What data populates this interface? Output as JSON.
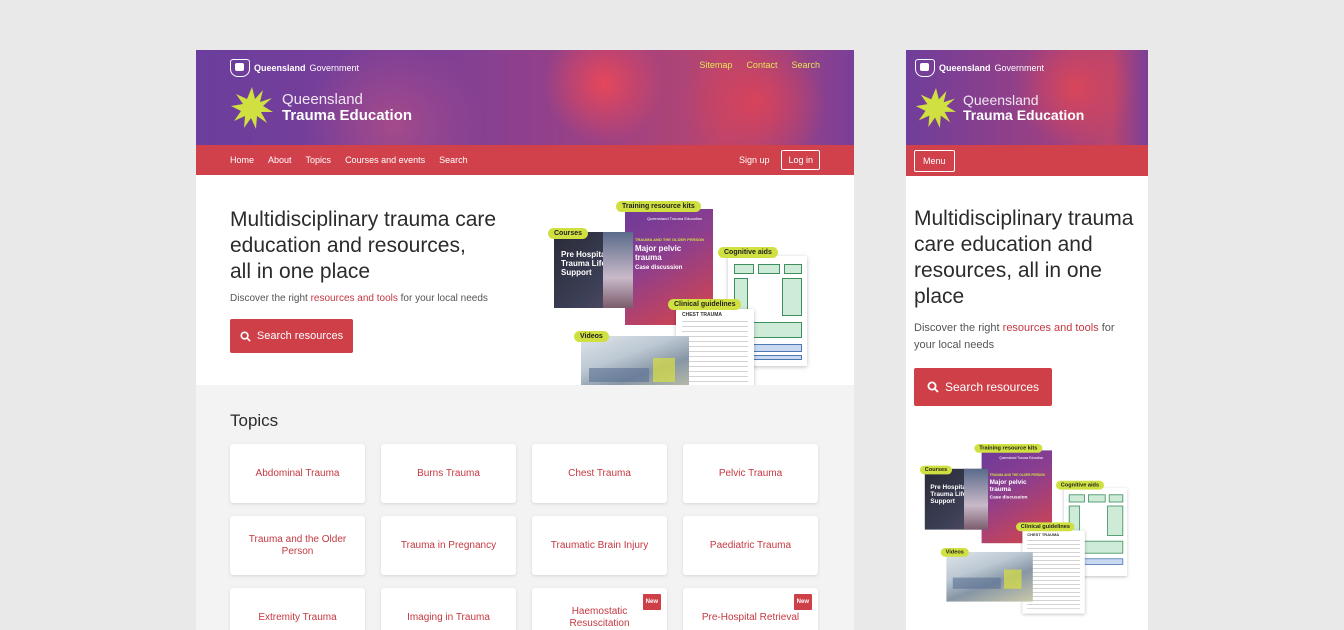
{
  "header": {
    "government": {
      "bold": "Queensland",
      "rest": "Government"
    },
    "utility_links": [
      "Sitemap",
      "Contact",
      "Search"
    ],
    "brand_line1": "Queensland",
    "brand_line2": "Trauma Education"
  },
  "nav": {
    "items": [
      "Home",
      "About",
      "Topics",
      "Courses and events",
      "Search"
    ],
    "signup": "Sign up",
    "login": "Log in",
    "menu": "Menu"
  },
  "hero": {
    "title_line1": "Multidisciplinary trauma care",
    "title_line2": "education and resources,",
    "title_line3": "all in one place",
    "mobile_title": "Multidisciplinary trauma care education and resources, all in one place",
    "desc_before": "Discover the right ",
    "desc_link": "resources and tools",
    "desc_after": " for your local needs",
    "button": "Search resources"
  },
  "collage": {
    "tags": {
      "training": "Training resource kits",
      "courses": "Courses",
      "cognitive": "Cognitive aids",
      "clinical": "Clinical guidelines",
      "videos": "Videos"
    },
    "course_title": "Pre Hospital Trauma Life Support",
    "poster_brand": "Queensland Trauma Education",
    "poster_sub": "TRAUMA AND THE OLDER PERSON",
    "poster_title": "Major pelvic trauma",
    "poster_case": "Case discussion",
    "guideline_title": "CHEST TRAUMA"
  },
  "topics": {
    "heading": "Topics",
    "items": [
      {
        "label": "Abdominal Trauma",
        "badge": ""
      },
      {
        "label": "Burns Trauma",
        "badge": ""
      },
      {
        "label": "Chest Trauma",
        "badge": ""
      },
      {
        "label": "Pelvic Trauma",
        "badge": ""
      },
      {
        "label": "Trauma and the Older Person",
        "badge": ""
      },
      {
        "label": "Trauma in Pregnancy",
        "badge": ""
      },
      {
        "label": "Traumatic Brain Injury",
        "badge": ""
      },
      {
        "label": "Paediatric Trauma",
        "badge": ""
      },
      {
        "label": "Extremity Trauma",
        "badge": ""
      },
      {
        "label": "Imaging in Trauma",
        "badge": ""
      },
      {
        "label": "Haemostatic Resuscitation",
        "badge": "New"
      },
      {
        "label": "Pre-Hospital Retrieval",
        "badge": "New"
      }
    ]
  },
  "colors": {
    "accent": "#cf3f48",
    "brand_yellow": "#cfe040",
    "banner_purple": "#6b3e9d"
  },
  "icons": {
    "search": "search-icon",
    "logo": "star-logo-icon",
    "crest": "qld-crest-icon"
  }
}
